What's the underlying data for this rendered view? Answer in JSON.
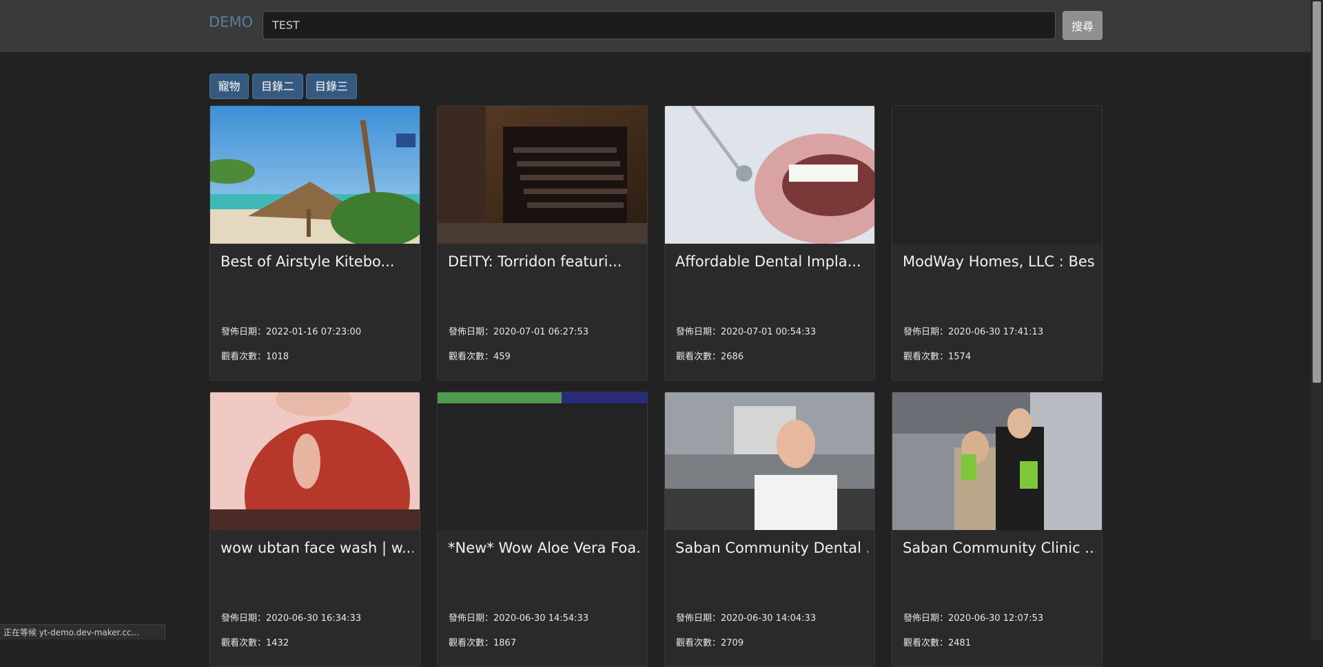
{
  "header": {
    "brand": "DEMO",
    "search_value": "TEST",
    "search_button": "搜尋"
  },
  "tabs": [
    "寵物",
    "目錄二",
    "目錄三"
  ],
  "labels": {
    "date_prefix": "發佈日期：",
    "views_prefix": "觀看次數："
  },
  "videos": [
    {
      "title": "Best of Airstyle Kitebo...",
      "date": "2022-01-16 07:23:00",
      "views": "1018",
      "thumb": "beach"
    },
    {
      "title": "DEITY: Torridon featuri...",
      "date": "2020-07-01 06:27:53",
      "views": "459",
      "thumb": "piano"
    },
    {
      "title": "Affordable Dental Impla...",
      "date": "2020-07-01 00:54:33",
      "views": "2686",
      "thumb": "teeth"
    },
    {
      "title": "ModWay Homes, LLC : Bes...",
      "date": "2020-06-30 17:41:13",
      "views": "1574",
      "thumb": "blank"
    },
    {
      "title": "wow ubtan face wash | w...",
      "date": "2020-06-30 16:34:33",
      "views": "1432",
      "thumb": "person-red"
    },
    {
      "title": "*New* Wow Aloe Vera Foa...",
      "date": "2020-06-30 14:54:33",
      "views": "1867",
      "thumb": "dark-strip"
    },
    {
      "title": "Saban Community Dental ...",
      "date": "2020-06-30 14:04:33",
      "views": "2709",
      "thumb": "dentist-street"
    },
    {
      "title": "Saban Community Clinic ...",
      "date": "2020-06-30 12:07:53",
      "views": "2481",
      "thumb": "clinic-people"
    }
  ],
  "status_bar": "正在等候 yt-demo.dev-maker.cc..."
}
